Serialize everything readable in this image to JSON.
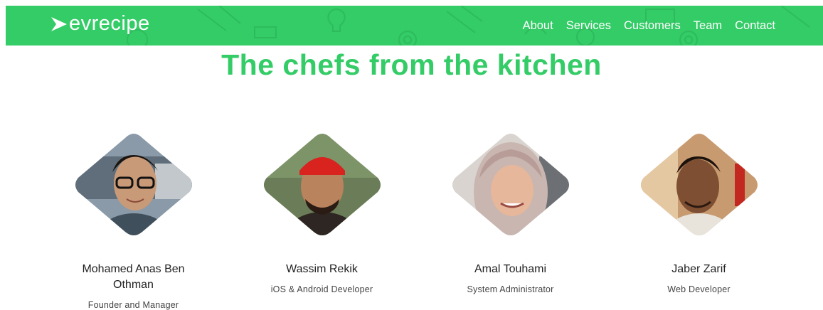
{
  "brand": {
    "logo_text": "evrecipe"
  },
  "nav": {
    "links": [
      "About",
      "Services",
      "Customers",
      "Team",
      "Contact"
    ]
  },
  "team_section": {
    "title": "The chefs from the kitchen",
    "members": [
      {
        "name": "Mohamed Anas Ben Othman",
        "role": "Founder and Manager"
      },
      {
        "name": "Wassim Rekik",
        "role": "iOS & Android Developer"
      },
      {
        "name": "Amal Touhami",
        "role": "System Administrator"
      },
      {
        "name": "Jaber Zarif",
        "role": "Web Developer"
      }
    ]
  },
  "colors": {
    "brand_green": "#33cc66",
    "text_dark": "#222222"
  }
}
